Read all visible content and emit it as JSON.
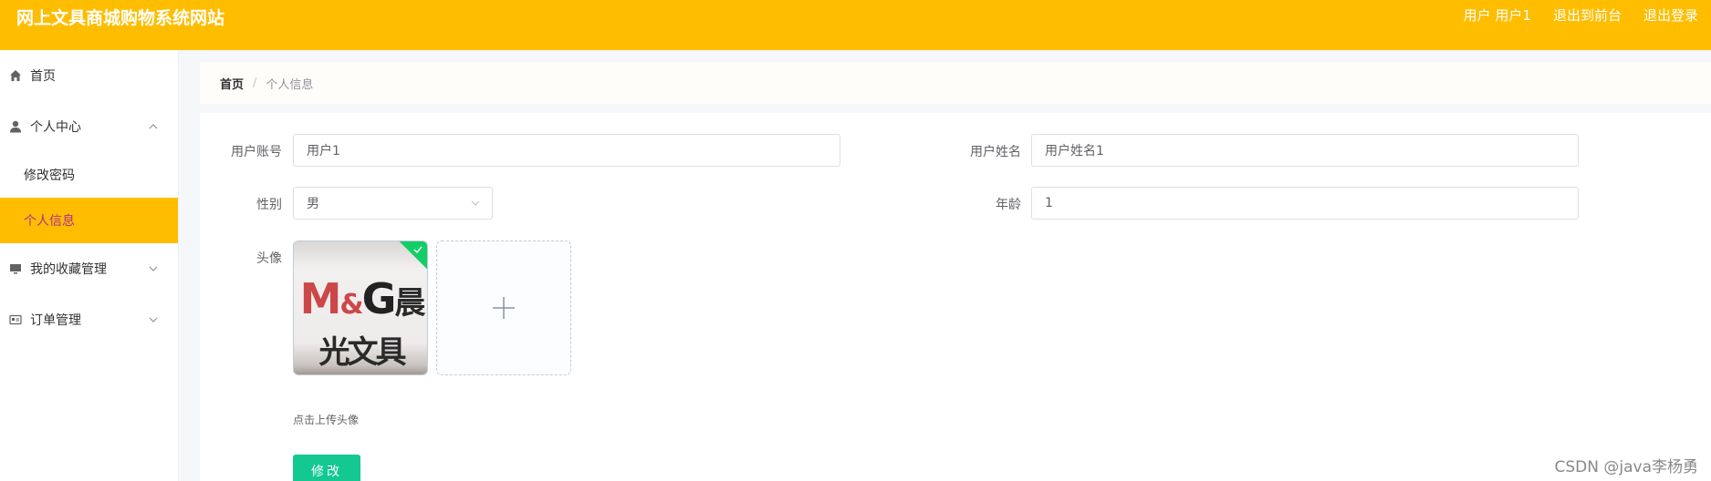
{
  "header": {
    "title": "网上文具商城购物系统网站",
    "user_label": "用户 用户1",
    "to_frontend": "退出到前台",
    "logout": "退出登录"
  },
  "sidebar": {
    "items": [
      {
        "label": "首页",
        "icon": "home-icon"
      },
      {
        "label": "个人中心",
        "icon": "user-icon",
        "expanded": true,
        "children": [
          {
            "label": "修改密码"
          },
          {
            "label": "个人信息",
            "active": true
          }
        ]
      },
      {
        "label": "我的收藏管理",
        "icon": "monitor-icon",
        "expanded": false
      },
      {
        "label": "订单管理",
        "icon": "id-card-icon",
        "expanded": false
      }
    ]
  },
  "breadcrumb": {
    "home": "首页",
    "separator": "/",
    "current": "个人信息"
  },
  "form": {
    "account": {
      "label": "用户账号",
      "value": "用户1"
    },
    "name": {
      "label": "用户姓名",
      "value": "用户姓名1"
    },
    "gender": {
      "label": "性别",
      "value": "男"
    },
    "age": {
      "label": "年龄",
      "value": "1"
    },
    "avatar": {
      "label": "头像",
      "hint": "点击上传头像",
      "logo_m": "M",
      "logo_amp": "&",
      "logo_g": "G",
      "logo_cn": "晨光文具"
    },
    "submit_label": "修改"
  },
  "watermark": "CSDN @java李杨勇",
  "colors": {
    "header_bg": "#ffbd00",
    "active_item_bg": "#ffbd00",
    "active_item_text": "#b0308f",
    "submit_bg": "#13c891",
    "success_badge": "#13ce66"
  }
}
